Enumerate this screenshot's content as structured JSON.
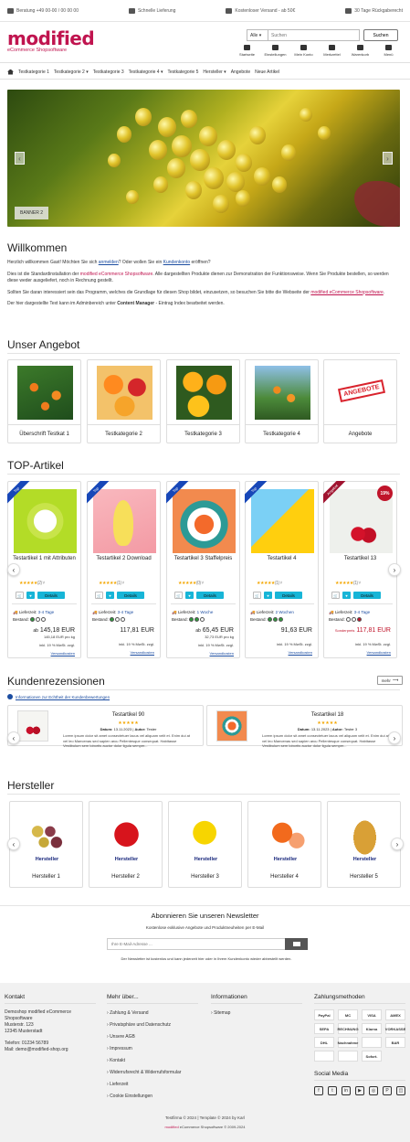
{
  "topbar": {
    "phone": "Beratung +49 00-00 / 00 00 00",
    "delivery": "Schnelle Lieferung",
    "shipping": "Kostenloser Versand - ab 50€",
    "returns": "30 Tage Rückgaberecht"
  },
  "header": {
    "logo": "modified",
    "logo_sub": "eCommerce Shopsoftware",
    "search_category": "Alle",
    "search_placeholder": "Suchen",
    "search_button": "Suchen",
    "icons": [
      {
        "label": "Startseite",
        "icon": "home-icon"
      },
      {
        "label": "Einstellungen",
        "icon": "gear-icon"
      },
      {
        "label": "Mein Konto",
        "icon": "user-icon"
      },
      {
        "label": "Merkzettel",
        "icon": "heart-icon"
      },
      {
        "label": "Warenkorb",
        "icon": "cart-icon"
      },
      {
        "label": "Menü",
        "icon": "menu-icon"
      }
    ]
  },
  "nav": [
    "Testkategorie 1",
    "Testkategorie 2 ▾",
    "Testkategorie 3",
    "Testkategorie 4 ▾",
    "Testkategorie 5",
    "Hersteller ▾",
    "Angebote",
    "Neue Artikel"
  ],
  "banner": {
    "label": "BANNER 2"
  },
  "welcome": {
    "title": "Willkommen",
    "p1_pre": "Herzlich willkommen Gast! Möchten Sie sich ",
    "p1_link1": "anmelden",
    "p1_mid": "? Oder wollen Sie ein ",
    "p1_link2": "Kundenkonto",
    "p1_post": " eröffnen?",
    "p2_pre": "Dies ist die Standardinstallation der ",
    "p2_brand": "modified eCommerce Shopsoftware",
    "p2_post": ". Alle dargestellten Produkte dienen zur Demonstration der Funktionsweise. Wenn Sie Produkte bestellen, so werden diese weder ausgeliefert, noch in Rechnung gestellt.",
    "p3_pre": "Sollten Sie daran interessiert sein das Programm, welches die Grundlage für diesen Shop bildet, einzusetzen, so besuchen Sie bitte die Webseite der ",
    "p3_link": "modified eCommerce Shopsoftware",
    "p3_post": ".",
    "p4_pre": "Der hier dargestellte Text kann im Adminbereich unter ",
    "p4_bold": "Content Manager",
    "p4_post": " - Eintrag Index bearbeitet werden."
  },
  "offer": {
    "title": "Unser Angebot",
    "items": [
      "Überschrift Testkat 1",
      "Testkategorie 2",
      "Testkategorie 3",
      "Testkategorie 4",
      "Angebote"
    ],
    "angebote_stamp": "ANGEBOTE"
  },
  "top": {
    "title": "TOP-Artikel",
    "details": "Details",
    "lieferzeit_label": "Lieferzeit:",
    "bestand_label": "Bestand:",
    "products": [
      {
        "name": "Testartikel 1 mit Attributen",
        "badge": "Top",
        "rating": "(2)",
        "lieferzeit": "3-4 Tage",
        "price_prefix": "ab",
        "price": "145,18 EUR",
        "unit": "145,18 EUR pro kg",
        "tax": "inkl. 19 % MwSt. zzgl.",
        "ship": "Versandkosten"
      },
      {
        "name": "Testartikel 2 Download",
        "badge": "Top",
        "rating": "(1)",
        "lieferzeit": "3-4 Tage",
        "price_prefix": "",
        "price": "117,81 EUR",
        "unit": "",
        "tax": "inkl. 19 % MwSt. zzgl.",
        "ship": "Versandkosten"
      },
      {
        "name": "Testartikel 3 Staffelpreis",
        "badge": "Top",
        "rating": "(0)",
        "lieferzeit": "1 Woche",
        "price_prefix": "ab",
        "price": "65,45 EUR",
        "unit": "32,73 EUR pro kg",
        "tax": "inkl. 19 % MwSt. zzgl.",
        "ship": "Versandkosten"
      },
      {
        "name": "Testartikel 4",
        "badge": "Top",
        "rating": "(1)",
        "lieferzeit": "2 Wochen",
        "price_prefix": "",
        "price": "91,63 EUR",
        "unit": "",
        "tax": "inkl. 19 % MwSt. zzgl.",
        "ship": "Versandkosten"
      },
      {
        "name": "Testartikel 13",
        "badge": "Angebot",
        "discount": "19%",
        "rating": "(1)",
        "lieferzeit": "3-4 Tage",
        "price_prefix": "Sonderpreis",
        "price": "117,81 EUR",
        "unit": "",
        "tax": "inkl. 19 % MwSt. zzgl.",
        "ship": "Versandkosten"
      }
    ]
  },
  "reviews": {
    "title": "Kundenrezensionen",
    "more": "mehr",
    "info": "Informationen zur Echtheit der Kundenbewertungen",
    "items": [
      {
        "product": "Testartikel 90",
        "stars": "★★★★★",
        "date_label": "Datum:",
        "date": "13.11.2023",
        "author_label": "Autor:",
        "author": "Tester",
        "text": "Lorem ipsum dolor sit amet consectetuer lacus vel aliquam velit et. Enim dui at vel leo Maecenas sed sapien arcu Pellentesque consequat. Habitasse Vestibulum sem lobortis auctor dolor ligula semper..."
      },
      {
        "product": "Testartikel 18",
        "stars": "★★★★★",
        "date_label": "Datum:",
        "date": "13.11.2023",
        "author_label": "Autor:",
        "author": "Tester 3",
        "text": "Lorem ipsum dolor sit amet consectetuer lacus vel aliquam velit et. Enim dui at vel leo Maecenas sed sapien arcu Pellentesque consequat. Habitasse Vestibulum sem lobortis auctor dolor ligula semper..."
      }
    ]
  },
  "manufacturers": {
    "title": "Hersteller",
    "img_label": "Hersteller",
    "items": [
      "Hersteller 1",
      "Hersteller 2",
      "Hersteller 3",
      "Hersteller 4",
      "Hersteller 5"
    ]
  },
  "newsletter": {
    "title": "Abonnieren Sie unseren Newsletter",
    "subtitle": "Kostenlose exklusive Angebote und Produktneuheiten per E-Mail",
    "placeholder": "Ihre E-Mail-Adresse ...",
    "note": "Der Newsletter ist kostenlos und kann jederzeit hier oder in Ihrem Kundenkonto wieder abbestellt werden."
  },
  "footer": {
    "contact_title": "Kontakt",
    "contact_lines": [
      "Demoshop modified eCommerce",
      "Shopsoftware",
      "Musterstr. 123",
      "12345 Musterstadt"
    ],
    "phone": "Telefon: 01234 56789",
    "mail": "Mail: demo@modified-shop.org",
    "more_title": "Mehr über...",
    "more_items": [
      "Zahlung & Versand",
      "Privatsphäre und Datenschutz",
      "Unsere AGB",
      "Impressum",
      "Kontakt",
      "Widerrufsrecht & Widerrufsformular",
      "Lieferzeit",
      "Cookie Einstellungen"
    ],
    "info_title": "Informationen",
    "info_items": [
      "Sitemap"
    ],
    "pay_title": "Zahlungsmethoden",
    "pay_items": [
      "PayPal",
      "MC",
      "VISA",
      "AMEX",
      "SEPA",
      "RECHNUNG",
      "Klarna",
      "VORKASSE",
      "DHL",
      "Nachnahme",
      "",
      "BAR",
      "",
      "",
      "Sofort."
    ],
    "social_title": "Social Media",
    "social_items": [
      "f",
      "t",
      "in",
      "▶",
      "◎",
      "P",
      "◫"
    ],
    "copyright": "Testfirma © 2024 | Template © 2024 by Karl",
    "powered_brand": "modified",
    "powered": " eCommerce Shopsoftware © 2009-2024"
  }
}
